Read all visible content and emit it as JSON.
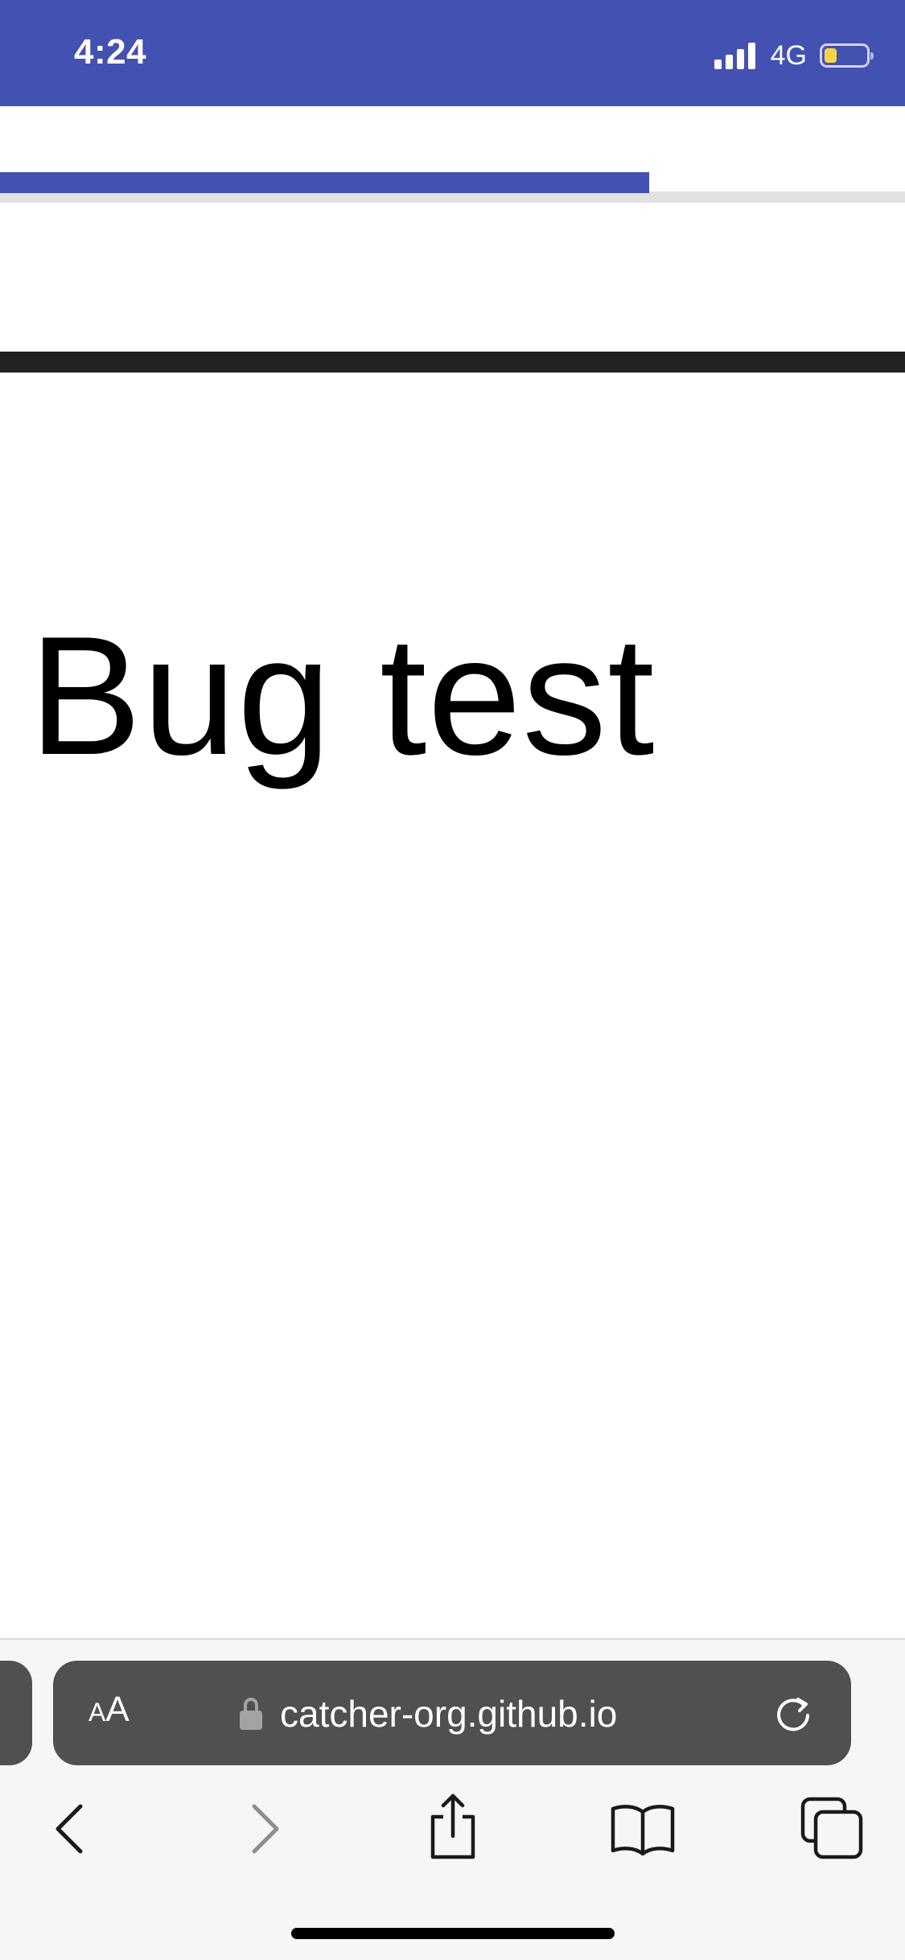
{
  "status_bar": {
    "time": "4:24",
    "network": "4G",
    "battery_level": 0.3,
    "background_color": "#4351b1",
    "battery_color": "#f5d547"
  },
  "page": {
    "progress": 0.717,
    "progress_color": "#4351b1",
    "heading": "Bug test"
  },
  "browser": {
    "text_size_small": "A",
    "text_size_large": "A",
    "url": "catcher-org.github.io",
    "icons": [
      "lock-icon",
      "reload-icon",
      "back-icon",
      "forward-icon",
      "share-icon",
      "bookmarks-icon",
      "tabs-icon"
    ]
  }
}
